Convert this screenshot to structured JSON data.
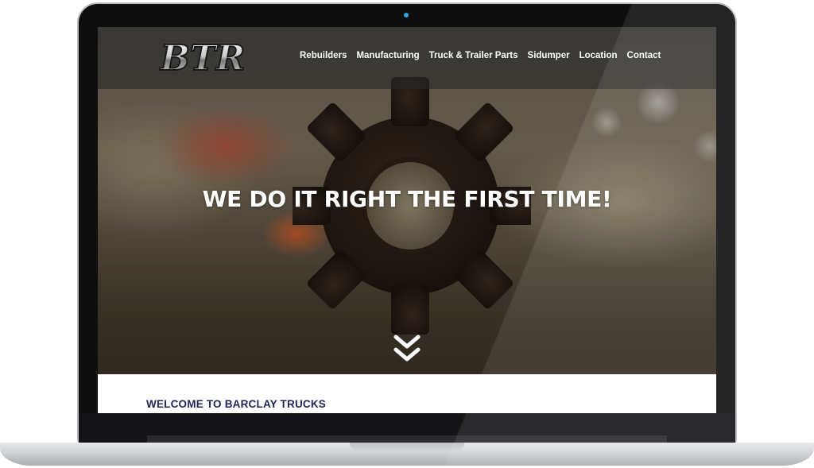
{
  "site": {
    "logo_text": "BTR",
    "nav": [
      {
        "label": "Rebuilders"
      },
      {
        "label": "Manufacturing"
      },
      {
        "label": "Truck & Trailer Parts"
      },
      {
        "label": "Sidumper"
      },
      {
        "label": "Location"
      },
      {
        "label": "Contact"
      }
    ],
    "hero": {
      "headline": "WE DO IT RIGHT THE FIRST TIME!"
    },
    "welcome": {
      "title": "WELCOME TO BARCLAY TRUCKS"
    }
  },
  "colors": {
    "camera": "#2aa7e0",
    "welcome_title": "#1c2555",
    "nav_text": "#ffffff"
  },
  "icons": {
    "scroll": "double-chevron-down-icon",
    "camera": "camera-dot"
  }
}
